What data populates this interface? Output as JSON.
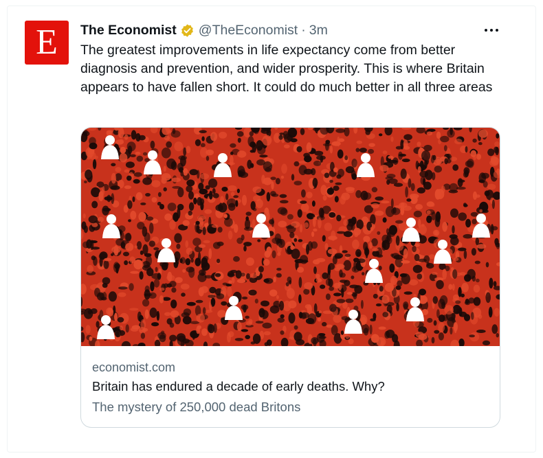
{
  "tweet": {
    "avatar_letter": "E",
    "author_name": "The Economist",
    "verified_icon": "verified-badge-icon",
    "handle": "@TheEconomist",
    "separator": "·",
    "time": "3m",
    "more_icon": "more-options-icon",
    "text": "The greatest improvements in life expectancy come from better diagnosis and prevention, and wider prosperity. This is where Britain appears to have fallen short. It could do much better in all three areas"
  },
  "card": {
    "domain": "economist.com",
    "title": "Britain has endured a decade of early deaths. Why?",
    "description": "The mystery of 250,000 dead Britons"
  },
  "colors": {
    "brand_red": "#e3120b",
    "image_red": "#c8321c",
    "verified_gold": "#e2b719",
    "secondary_text": "#536471",
    "primary_text": "#0f1419"
  }
}
